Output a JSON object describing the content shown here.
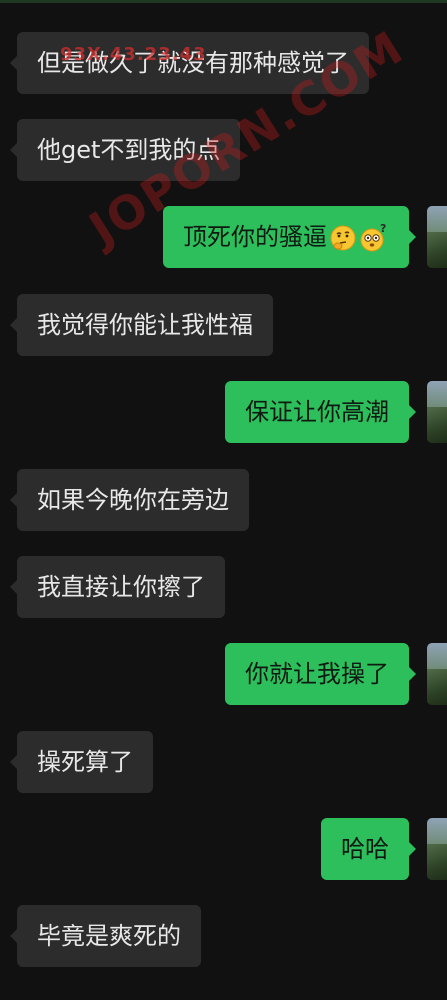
{
  "watermark": {
    "line1": "93X.43.23.43",
    "line2": "JOPORN.COM"
  },
  "messages": [
    {
      "side": "in",
      "text": "但是做久了就没有那种感觉了"
    },
    {
      "side": "in",
      "text": "他get不到我的点"
    },
    {
      "side": "out",
      "text": "顶死你的骚逼",
      "emojis": [
        "thinking-face-icon",
        "confused-face-icon"
      ]
    },
    {
      "side": "in",
      "text": "我觉得你能让我性福"
    },
    {
      "side": "out",
      "text": "保证让你高潮"
    },
    {
      "side": "in",
      "text": "如果今晚你在旁边"
    },
    {
      "side": "in",
      "text": "我直接让你擦了"
    },
    {
      "side": "out",
      "text": "你就让我操了"
    },
    {
      "side": "in",
      "text": "操死算了"
    },
    {
      "side": "out",
      "text": "哈哈"
    },
    {
      "side": "in",
      "text": "毕竟是爽死的"
    }
  ],
  "colors": {
    "background": "#111111",
    "incoming_bubble": "#2c2c2c",
    "outgoing_bubble": "#2dbf5b"
  }
}
